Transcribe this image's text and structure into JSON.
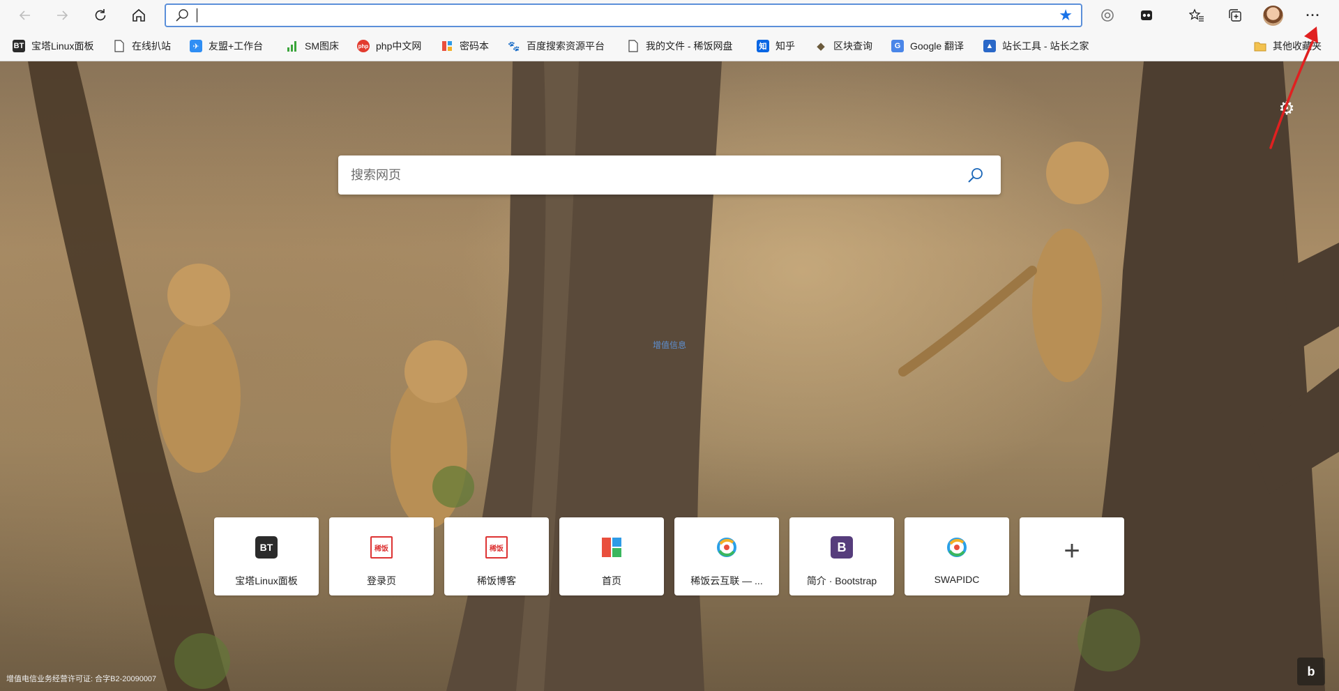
{
  "toolbar": {
    "address_value": "",
    "address_placeholder": "",
    "icons": {
      "back": "back-arrow-icon",
      "forward": "forward-arrow-icon",
      "refresh": "refresh-icon",
      "home": "home-icon",
      "favorite": "star-icon",
      "tracking": "tracking-prevention-icon",
      "extension": "extension-icon",
      "favorites_list": "favorites-icon",
      "collections": "collections-icon",
      "more": "more-icon"
    },
    "more_label": "···"
  },
  "bookmarks": {
    "items": [
      {
        "label": "宝塔Linux面板",
        "icon_text": "BT",
        "color": "#2b2b2b"
      },
      {
        "label": "在线扒站",
        "icon_text": "",
        "color": "#ffffff"
      },
      {
        "label": "友盟+工作台",
        "icon_text": "✈",
        "color": "#2f8ef4"
      },
      {
        "label": "SM图床",
        "icon_text": "▮",
        "color": "#3ba53b"
      },
      {
        "label": "php中文网",
        "icon_text": "php",
        "color": "#e23b2e"
      },
      {
        "label": "密码本",
        "icon_text": "▦",
        "color": "#e94f3d"
      },
      {
        "label": "百度搜索资源平台",
        "icon_text": "🐾",
        "color": "#2e6be6"
      },
      {
        "label": "我的文件 - 稀饭网盘",
        "icon_text": "",
        "color": "#ffffff"
      },
      {
        "label": "知乎",
        "icon_text": "知",
        "color": "#0a66e4"
      },
      {
        "label": "区块查询",
        "icon_text": "◆",
        "color": "#6b5a3c"
      },
      {
        "label": "Google 翻译",
        "icon_text": "G",
        "color": "#4a86e8"
      },
      {
        "label": "站长工具 - 站长之家",
        "icon_text": "▲",
        "color": "#2a68c8"
      }
    ],
    "other_label": "其他收藏夹"
  },
  "newtab": {
    "search_placeholder": "搜索网页",
    "center_caption": "增值信息",
    "icp_text": "增值电信业务经营许可证: 合字B2-20090007",
    "bing_label": "b",
    "tiles": [
      {
        "label": "宝塔Linux面板",
        "icon_text": "BT",
        "color": "#2b2b2b"
      },
      {
        "label": "登录页",
        "icon_text": "稀饭",
        "color": "#ffffff"
      },
      {
        "label": "稀饭博客",
        "icon_text": "稀饭",
        "color": "#ffffff"
      },
      {
        "label": "首页",
        "icon_text": "",
        "color": "#e94f3d"
      },
      {
        "label": "稀饭云互联 — ...",
        "icon_text": "◎",
        "color": "#ffffff"
      },
      {
        "label": "简介 · Bootstrap",
        "icon_text": "B",
        "color": "#563d7c"
      },
      {
        "label": "SWAPIDC",
        "icon_text": "◎",
        "color": "#ffffff"
      }
    ],
    "add_tile_label": "+"
  },
  "colors": {
    "accent": "#1a73e8",
    "address_border": "#5b8fd9",
    "annotation_arrow": "#e02020"
  }
}
